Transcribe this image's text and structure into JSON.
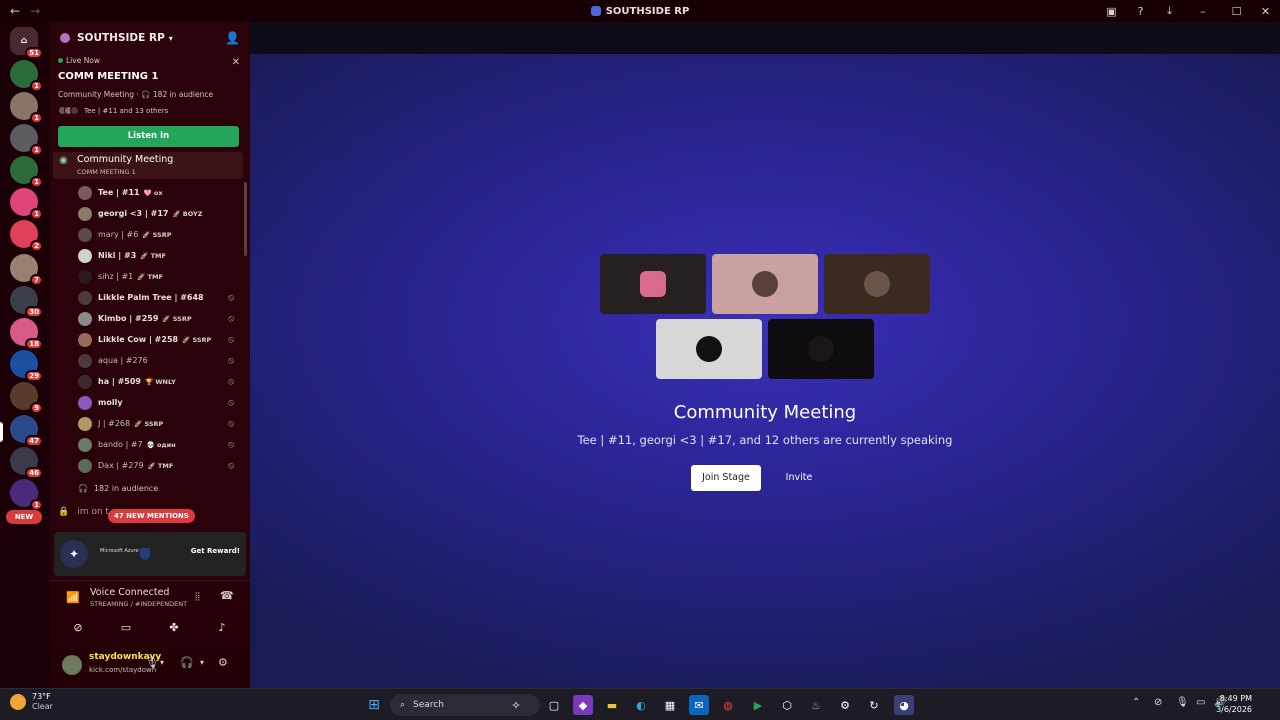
{
  "window": {
    "title": "SOUTHSIDE RP"
  },
  "guild_badges": [
    "51",
    "1",
    "1",
    "1",
    "1",
    "1",
    "2",
    "7",
    "30",
    "18",
    "29",
    "9",
    "47",
    "46",
    "1"
  ],
  "guild_new_label": "NEW",
  "server": {
    "name": "SOUTHSIDE RP"
  },
  "live_card": {
    "live_now": "Live Now",
    "title": "COMM MEETING 1",
    "meta": "Community Meeting · 🎧 182 in audience",
    "speakers_text": "Tee | #11 and 13 others",
    "listen_button": "Listen In"
  },
  "stage_channel": {
    "name": "Community Meeting",
    "topic": "COMM MEETING 1"
  },
  "users": [
    {
      "name": "Tee | #11",
      "tag": "🩷 ox",
      "bold": true
    },
    {
      "name": "georgi <3 | #17",
      "tag": "🚀 BOYZ",
      "bold": true
    },
    {
      "name": "mary | #6",
      "tag": "🚀 SSRP",
      "bold": false
    },
    {
      "name": "Niki | #3",
      "tag": "🚀 TMF",
      "bold": true
    },
    {
      "name": "sihz | #1",
      "tag": "🚀 TMF",
      "bold": false
    },
    {
      "name": "Likkle Palm Tree | #648",
      "tag": "",
      "bold": true
    },
    {
      "name": "Kimbo | #259",
      "tag": "🚀 SSRP",
      "bold": true
    },
    {
      "name": "Likkle Cow | #258",
      "tag": "🚀 SSRP",
      "bold": true
    },
    {
      "name": "aqua | #276",
      "tag": "",
      "bold": false
    },
    {
      "name": "ha | #509",
      "tag": "🏆 WNLY",
      "bold": true
    },
    {
      "name": "molly",
      "tag": "",
      "bold": true
    },
    {
      "name": "J | #268",
      "tag": "🚀 SSRP",
      "bold": false
    },
    {
      "name": "bando | #7",
      "tag": "💀 один",
      "bold": false
    },
    {
      "name": "Dax | #279",
      "tag": "🚀 TMF",
      "bold": false
    }
  ],
  "audience_text": "182 in audience",
  "locked_channel": "im on t",
  "mentions_pill": "47 NEW MENTIONS",
  "promo": {
    "brand": "Microsoft Azure",
    "reward": "Get Reward!"
  },
  "voice": {
    "status": "Voice Connected",
    "channel": "STREAMING / #INDEPENDENT"
  },
  "user": {
    "name": "staydownkayy",
    "status": "kick.com/staydown"
  },
  "stage": {
    "title": "Community Meeting",
    "subtitle": "Tee | #11, georgi <3 | #17, and 12 others are currently speaking",
    "join_button": "Join Stage",
    "invite_button": "Invite"
  },
  "taskbar": {
    "temp": "73°F",
    "condition": "Clear",
    "search": "Search",
    "time": "8:49 PM",
    "date": "3/6/2026"
  },
  "colors": {
    "accent_green": "#23a55a",
    "badge_red": "#d83c3e",
    "stage_bg": "#2c2496"
  },
  "icons": [
    "back-arrow-icon",
    "forward-arrow-icon",
    "inbox-icon",
    "help-icon",
    "download-icon",
    "minimize-icon",
    "maximize-icon",
    "close-icon",
    "add-member-icon",
    "stage-icon",
    "headphones-icon",
    "mute-icon",
    "lock-icon",
    "signal-icon",
    "soundwave-icon",
    "hangup-icon",
    "camera-off-icon",
    "screen-share-icon",
    "activities-icon",
    "soundboard-icon",
    "mic-icon",
    "settings-icon",
    "windows-start-icon",
    "search-icon"
  ]
}
